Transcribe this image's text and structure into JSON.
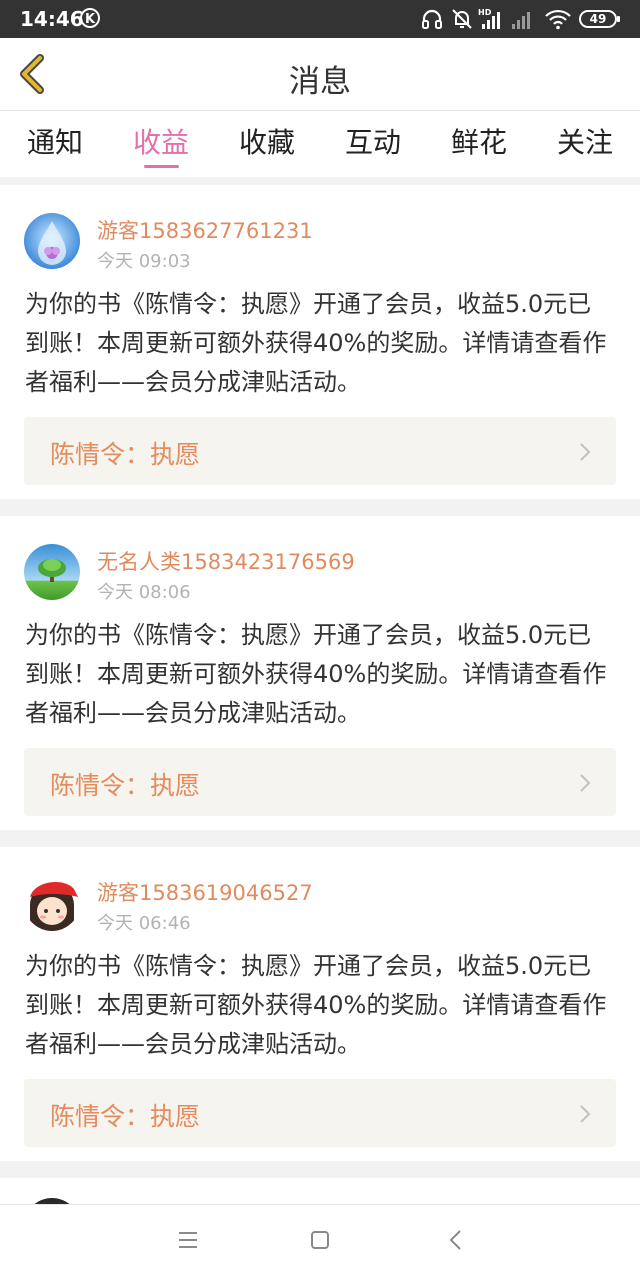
{
  "status_bar": {
    "time": "14:46",
    "k_badge": "K",
    "battery": "49",
    "icons": [
      "headphones-icon",
      "mute-bell-icon",
      "hd-signal-icon",
      "signal-icon",
      "wifi-icon",
      "battery-icon"
    ]
  },
  "header": {
    "title": "消息",
    "back_icon": "chevron-left-icon",
    "accent_color": "#e5b82b"
  },
  "tabs": [
    {
      "label": "通知",
      "active": false
    },
    {
      "label": "收益",
      "active": true
    },
    {
      "label": "收藏",
      "active": false
    },
    {
      "label": "互动",
      "active": false
    },
    {
      "label": "鲜花",
      "active": false
    },
    {
      "label": "关注",
      "active": false
    }
  ],
  "colors": {
    "active_tab": "#e56fa8",
    "username": "#e08b5f",
    "book_link": "#e58b5d",
    "book_link_bg": "#f5f4ef",
    "status_bar": "#333333"
  },
  "messages": [
    {
      "user": "游客1583627761231",
      "time": "今天 09:03",
      "avatar": "water-drop-flower-avatar",
      "text": "为你的书《陈情令：执愿》开通了会员，收益5.0元已到账！本周更新可额外获得40%的奖励。详情请查看作者福利——会员分成津贴活动。",
      "book": "陈情令：执愿"
    },
    {
      "user": "无名人类1583423176569",
      "time": "今天 08:06",
      "avatar": "tree-sky-avatar",
      "text": "为你的书《陈情令：执愿》开通了会员，收益5.0元已到账！本周更新可额外获得40%的奖励。详情请查看作者福利——会员分成津贴活动。",
      "book": "陈情令：执愿"
    },
    {
      "user": "游客1583619046527",
      "time": "今天 06:46",
      "avatar": "girl-red-hat-avatar",
      "text": "为你的书《陈情令：执愿》开通了会员，收益5.0元已到账！本周更新可额外获得40%的奖励。详情请查看作者福利——会员分成津贴活动。",
      "book": "陈情令：执愿"
    }
  ],
  "bottom_nav": [
    "menu-icon",
    "home-square-icon",
    "back-triangle-icon"
  ]
}
